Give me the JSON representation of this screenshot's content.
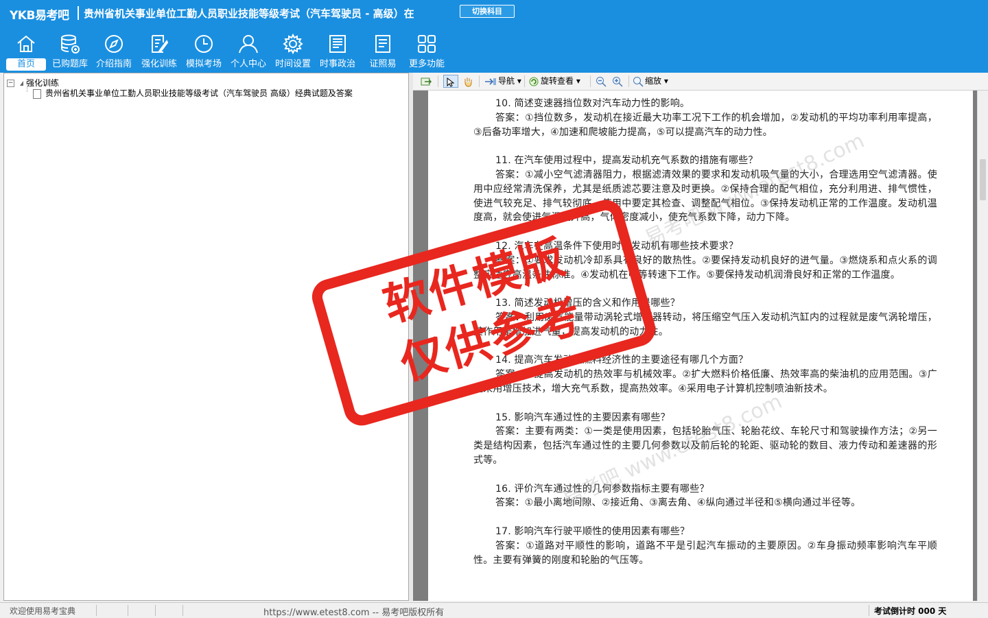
{
  "header": {
    "brand": "YKB易考吧",
    "title": "贵州省机关事业单位工勤人员职业技能等级考试（汽车驾驶员 - 高级）在",
    "switch_label": "切换科目",
    "bg_color": "#1a8fe0"
  },
  "nav": [
    {
      "label": "首页",
      "icon": "home-icon",
      "active": true
    },
    {
      "label": "已购题库",
      "icon": "database-icon"
    },
    {
      "label": "介绍指南",
      "icon": "compass-icon"
    },
    {
      "label": "强化训练",
      "icon": "edit-icon"
    },
    {
      "label": "模拟考场",
      "icon": "clock-icon"
    },
    {
      "label": "个人中心",
      "icon": "user-icon"
    },
    {
      "label": "时间设置",
      "icon": "gear-icon"
    },
    {
      "label": "时事政治",
      "icon": "newspaper-icon"
    },
    {
      "label": "证照易",
      "icon": "certificate-icon"
    },
    {
      "label": "更多功能",
      "icon": "grid-icon"
    }
  ],
  "tree": {
    "root": "强化训练",
    "child": "贵州省机关事业单位工勤人员职业技能等级考试（汽车驾驶员 高级）经典试题及答案"
  },
  "toolbar": {
    "nav_label": "导航",
    "rotate_label": "旋转查看",
    "zoom_label": "缩放"
  },
  "document": {
    "items": [
      {
        "q": "10. 简述变速器挡位数对汽车动力性的影响。",
        "a": "答案：①挡位数多，发动机在接近最大功率工况下工作的机会增加，②发动机的平均功率利用率提高，③后备功率增大，④加速和爬坡能力提高，⑤可以提高汽车的动力性。"
      },
      {
        "q": "11. 在汽车使用过程中，提高发动机充气系数的措施有哪些？",
        "a": "答案：①减小空气滤清器阻力，根据滤清效果的要求和发动机吸气量的大小，合理选用空气滤清器。使用中应经常清洗保养，尤其是纸质滤芯要注意及时更换。②保持合理的配气相位，充分利用进、排气惯性，使进气较充足、排气较彻底。使用中要定其检查、调整配气相位。③保持发动机正常的工作温度。发动机温度高，就会使进气温度升高，气体密度减小，使充气系数下降，动力下降。"
      },
      {
        "q": "12. 汽车在高温条件下使用时对发动机有哪些技术要求？",
        "a": "答案：①要求发动机冷却系具有良好的散热性。②要保持发动机良好的进气量。③燃烧系和点火系的调整应适应高温条件标准。④发动机在中等转速下工作。⑤要保持发动机润滑良好和正常的工作温度。"
      },
      {
        "q": "13. 简述发动机增压的含义和作用是哪些？",
        "a": "答案：利用废气能量带动涡轮式增压器转动，将压缩空气压入发动机汽缸内的过程就是废气涡轮增压，其作用是增加进气量，提高发动机的动力性。"
      },
      {
        "q": "14. 提高汽车发动机燃料经济性的主要途径有哪几个方面？",
        "a": "答案：①提高发动机的热效率与机械效率。②扩大燃料价格低廉、热效率高的柴油机的应用范围。③广泛采用增压技术，增大充气系数，提高热效率。④采用电子计算机控制喷油新技术。"
      },
      {
        "q": "15. 影响汽车通过性的主要因素有哪些？",
        "a": "答案：主要有两类：①一类是使用因素，包括轮胎气压、轮胎花纹、车轮尺寸和驾驶操作方法；②另一类是结构因素，包括汽车通过性的主要几何参数以及前后轮的轮距、驱动轮的数目、液力传动和差速器的形式等。"
      },
      {
        "q": "16. 评价汽车通过性的几何参数指标主要有哪些？",
        "a": "答案：①最小离地间隙、②接近角、③离去角、④纵向通过半径和⑤横向通过半径等。"
      },
      {
        "q": "17. 影响汽车行驶平顺性的使用因素有哪些？",
        "a": "答案：①道路对平顺性的影响，道路不平是引起汽车振动的主要原因。②车身振动频率影响汽车平顺性。主要有弹簧的刚度和轮胎的气压等。"
      }
    ],
    "watermark": "易考吧 www.etest8.com"
  },
  "stamp": {
    "line1": "软件模版",
    "line2": "仅供参考",
    "color": "#e8271f"
  },
  "status": {
    "welcome": "欢迎使用易考宝典",
    "copyright": "https://www.etest8.com -- 易考吧版权所有",
    "countdown": "考试倒计时 000 天"
  }
}
